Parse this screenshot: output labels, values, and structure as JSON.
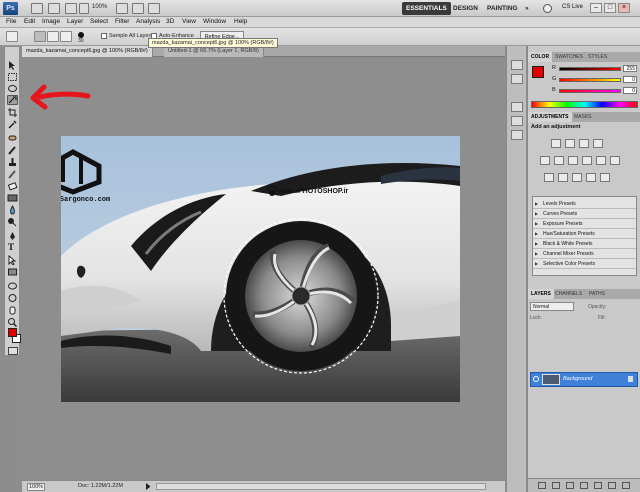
{
  "app": {
    "logo": "Ps",
    "zoom": "100%",
    "workspaces": [
      "ESSENTIALS",
      "DESIGN",
      "PAINTING"
    ],
    "more": "»",
    "cs_live": "CS Live",
    "window_buttons": [
      "–",
      "□",
      "×"
    ]
  },
  "menu": [
    "File",
    "Edit",
    "Image",
    "Layer",
    "Select",
    "Filter",
    "Analysis",
    "3D",
    "View",
    "Window",
    "Help"
  ],
  "options": {
    "sample_all_layers": "Sample All Layers",
    "auto_enhance": "Auto-Enhance",
    "refine_edge": "Refine Edge...",
    "brush_size": "30"
  },
  "tabs": [
    {
      "label": "mazda_kazamai_concept6.jpg @ 100% (RGB/8#)",
      "active": true
    },
    {
      "label": "Untitled-1 @ 66.7% (Layer 1, RGB/8)",
      "active": false
    }
  ],
  "tooltip": "mazda_kazamai_concept6.jpg @ 100% (RGB/8#)",
  "watermark": {
    "site_left": "www.Sargonco.com",
    "site_right": "www.iPHOTOSHOP.ir"
  },
  "status": {
    "zoom": "100%",
    "doc": "Doc: 1.22M/1.22M"
  },
  "color_panel": {
    "tabs": [
      "COLOR",
      "SWATCHES",
      "STYLES"
    ],
    "channels": [
      {
        "label": "R",
        "value": "255"
      },
      {
        "label": "G",
        "value": "0"
      },
      {
        "label": "B",
        "value": "0"
      }
    ],
    "foreground": "#e00000"
  },
  "adjustments_panel": {
    "tabs": [
      "ADJUSTMENTS",
      "MASKS"
    ],
    "heading": "Add an adjustment",
    "presets": [
      "Levels Presets",
      "Curves Presets",
      "Exposure Presets",
      "Hue/Saturation Presets",
      "Black & White Presets",
      "Channel Mixer Presets",
      "Selective Color Presets"
    ]
  },
  "layers_panel": {
    "tabs": [
      "LAYERS",
      "CHANNELS",
      "PATHS"
    ],
    "blend_mode": "Normal",
    "opacity_label": "Opacity:",
    "lock_label": "Lock:",
    "fill_label": "Fill:",
    "layer_name": "Background"
  },
  "colors": {
    "accent_red": "#e00000",
    "layer_selected": "#3f80d8"
  }
}
